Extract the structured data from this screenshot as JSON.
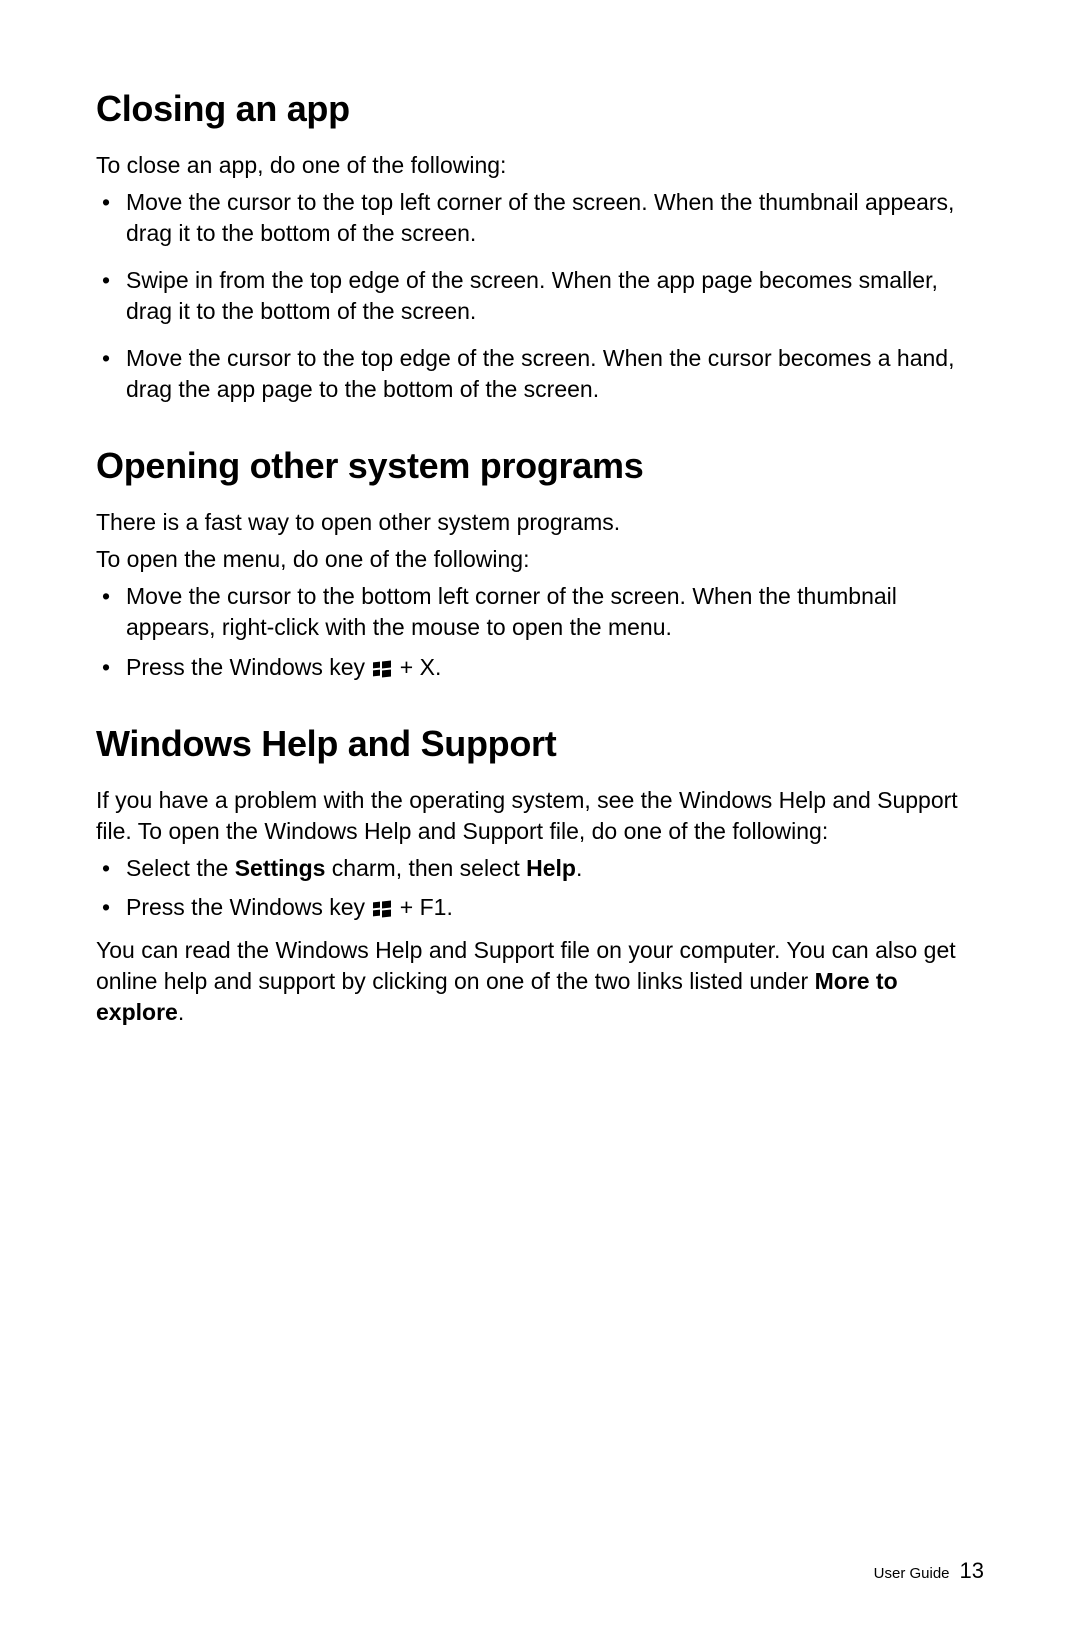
{
  "sections": [
    {
      "heading": "Closing an app",
      "intro": [
        "To close an app, do one of the following:"
      ],
      "bullets": [
        [
          {
            "t": "text",
            "v": "Move the cursor to the top left corner of the screen. When the thumbnail appears, drag it to the bottom of the screen."
          }
        ],
        [
          {
            "t": "text",
            "v": "Swipe in from the top edge of the screen. When the app page becomes smaller, drag it to the bottom of the screen."
          }
        ],
        [
          {
            "t": "text",
            "v": "Move the cursor to the top edge of the screen. When the cursor becomes a hand, drag the app page to the bottom of the screen."
          }
        ]
      ],
      "tight": false
    },
    {
      "heading": "Opening other system programs",
      "intro": [
        "There is a fast way to open other system programs.",
        "To open the menu, do one of the following:"
      ],
      "bullets": [
        [
          {
            "t": "text",
            "v": "Move the cursor to the bottom left corner of the screen. When the thumbnail appears, right-click with the mouse to open the menu."
          }
        ],
        [
          {
            "t": "text",
            "v": "Press the Windows key "
          },
          {
            "t": "winkey"
          },
          {
            "t": "text",
            "v": " + X."
          }
        ]
      ],
      "tight": true
    },
    {
      "heading": "Windows Help and Support",
      "intro": [
        "If you have a problem with the operating system, see the Windows Help and Support file. To open the Windows Help and Support file, do one of the following:"
      ],
      "bullets": [
        [
          {
            "t": "text",
            "v": "Select the "
          },
          {
            "t": "bold",
            "v": "Settings"
          },
          {
            "t": "text",
            "v": " charm, then select "
          },
          {
            "t": "bold",
            "v": "Help"
          },
          {
            "t": "text",
            "v": "."
          }
        ],
        [
          {
            "t": "text",
            "v": "Press the Windows key "
          },
          {
            "t": "winkey"
          },
          {
            "t": "text",
            "v": " + F1."
          }
        ]
      ],
      "outro": [
        [
          {
            "t": "text",
            "v": "You can read the Windows Help and Support file on your computer. You can also get online help and support by clicking on one of the two links listed under "
          },
          {
            "t": "bold",
            "v": "More to explore"
          },
          {
            "t": "text",
            "v": "."
          }
        ]
      ],
      "tight": true
    }
  ],
  "footer": {
    "label": "User Guide",
    "page": "13"
  }
}
